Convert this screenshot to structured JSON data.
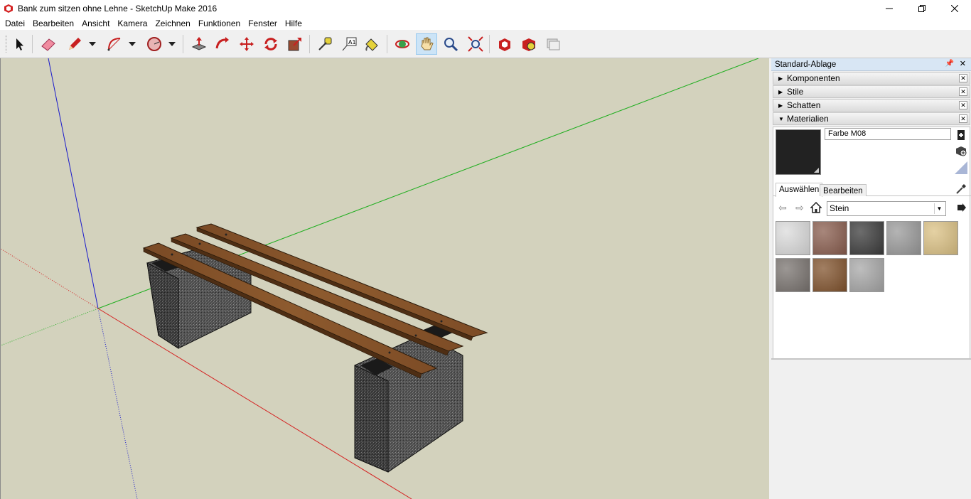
{
  "window": {
    "title": "Bank zum sitzen ohne Lehne - SketchUp Make 2016",
    "controls": [
      "minimize",
      "restore",
      "close"
    ]
  },
  "menu": [
    "Datei",
    "Bearbeiten",
    "Ansicht",
    "Kamera",
    "Zeichnen",
    "Funktionen",
    "Fenster",
    "Hilfe"
  ],
  "toolbar": {
    "tools": [
      "select",
      "eraser",
      "pencil",
      "arc",
      "shapes",
      "push-pull",
      "follow-me",
      "move",
      "rotate",
      "scale",
      "tape-measure",
      "text",
      "paint-bucket",
      "orbit",
      "pan",
      "zoom",
      "zoom-extents",
      "3d-warehouse",
      "extension-warehouse",
      "layout"
    ],
    "active_tool": "pan"
  },
  "tray": {
    "title": "Standard-Ablage",
    "panels": [
      {
        "label": "Komponenten",
        "expanded": false
      },
      {
        "label": "Stile",
        "expanded": false
      },
      {
        "label": "Schatten",
        "expanded": false
      },
      {
        "label": "Materialien",
        "expanded": true
      }
    ],
    "materials": {
      "current_name": "Farbe M08",
      "current_color": "#222222",
      "tabs": [
        "Auswählen",
        "Bearbeiten"
      ],
      "active_tab": "Auswählen",
      "library": "Stein",
      "swatches": [
        {
          "name": "marble-white",
          "color": "#dcdcdc"
        },
        {
          "name": "granite-brown",
          "color": "#8a5e4f"
        },
        {
          "name": "granite-dark",
          "color": "#3c3c3c"
        },
        {
          "name": "concrete-grey",
          "color": "#9b9b9b"
        },
        {
          "name": "sandstone",
          "color": "#dcc285"
        },
        {
          "name": "granite-grey",
          "color": "#7a7470"
        },
        {
          "name": "brown-stone",
          "color": "#82542e"
        },
        {
          "name": "granite-light",
          "color": "#a8a8a8"
        }
      ]
    }
  },
  "viewport": {
    "background": "#d3d2bd",
    "axes": {
      "red": "#d42020",
      "green": "#1fae1f",
      "blue": "#1a1acc"
    }
  }
}
